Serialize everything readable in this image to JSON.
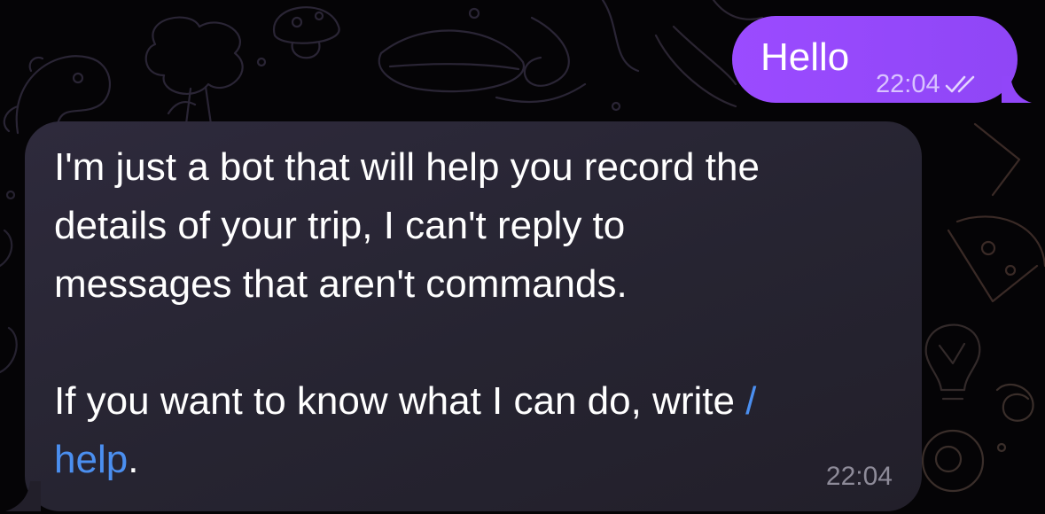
{
  "colors": {
    "background": "#050406",
    "outgoing_bubble": "#9b4bff",
    "incoming_bubble": "#2a2735",
    "command_link": "#4b8ff0",
    "outgoing_time": "#d9c3ff",
    "incoming_time": "#8e8b99"
  },
  "outgoing_message": {
    "text": "Hello",
    "time": "22:04",
    "status_icon": "double-check-read-icon"
  },
  "incoming_message": {
    "lines": [
      "I'm just a bot that will help you record the",
      "details of your trip, I can't reply to",
      "messages that aren't commands."
    ],
    "second_paragraph": {
      "line1_text": "If you want to know what I can do, write ",
      "line1_command": "/",
      "line2_command": "help",
      "line2_text": "."
    },
    "time": "22:04"
  },
  "wallpaper_icons": [
    "mushroom-doodle-icon",
    "tree-doodle-icon",
    "dinosaur-doodle-icon",
    "pizza-doodle-icon",
    "lightbulb-doodle-icon",
    "spiral-doodle-icon",
    "billiard-ball-doodle-icon"
  ]
}
